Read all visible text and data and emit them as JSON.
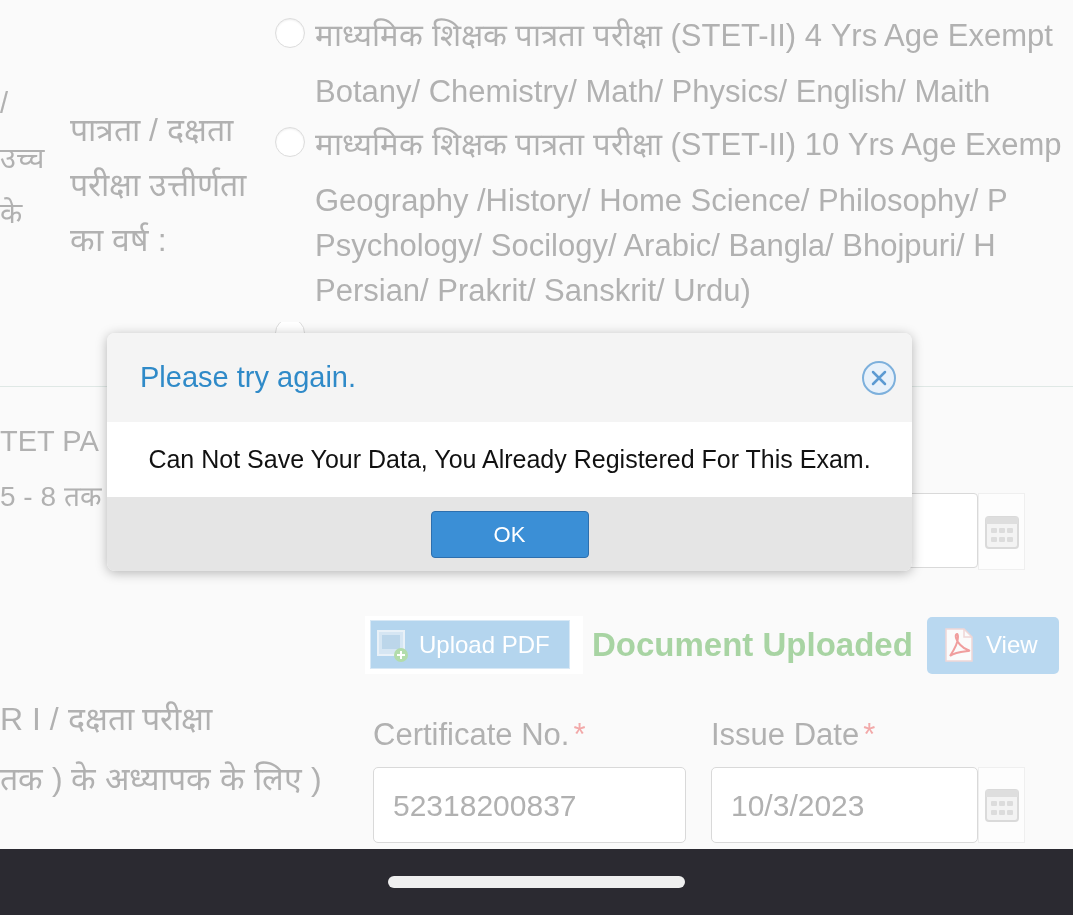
{
  "form": {
    "left_fragments": [
      "/",
      "उच्च",
      "के"
    ],
    "year_label": [
      "पात्रता / दक्षता",
      "परीक्षा उत्तीर्णता",
      "का वर्ष :"
    ],
    "options": [
      {
        "selected": false,
        "label": "माध्यमिक शिक्षक पात्रता परीक्षा (STET-II) 4 Yrs Age Exempt",
        "description": [
          "Botany/ Chemistry/ Math/ Physics/ English/ Maith"
        ]
      },
      {
        "selected": false,
        "label": "माध्यमिक शिक्षक पात्रता परीक्षा (STET-II) 10 Yrs Age Exemp",
        "description": [
          "Geography /History/ Home Science/ Philosophy/ P",
          "Psychology/ Socilogy/ Arabic/ Bangla/ Bhojpuri/ H",
          "Persian/ Prakrit/ Sanskrit/ Urdu)"
        ]
      },
      {
        "selected": false
      }
    ]
  },
  "section": {
    "heading": "TET PA",
    "class_range": "5 - 8 तक",
    "upload_button": "Upload PDF",
    "upload_status": "Document Uploaded",
    "view_button": "View",
    "category_label": [
      "R I / दक्षता परीक्षा",
      "तक ) के अध्यापक के लिए )"
    ],
    "fields": [
      {
        "kind": "text",
        "label": "Certificate No.",
        "required_mark": "*",
        "value": "52318200837"
      },
      {
        "kind": "date",
        "label": "Issue Date",
        "required_mark": "*",
        "value": "10/3/2023"
      }
    ]
  },
  "dialog": {
    "title": "Please try again.",
    "message": "Can Not Save Your Data, You Already Registered For This Exam.",
    "buttons": [
      "OK"
    ]
  }
}
